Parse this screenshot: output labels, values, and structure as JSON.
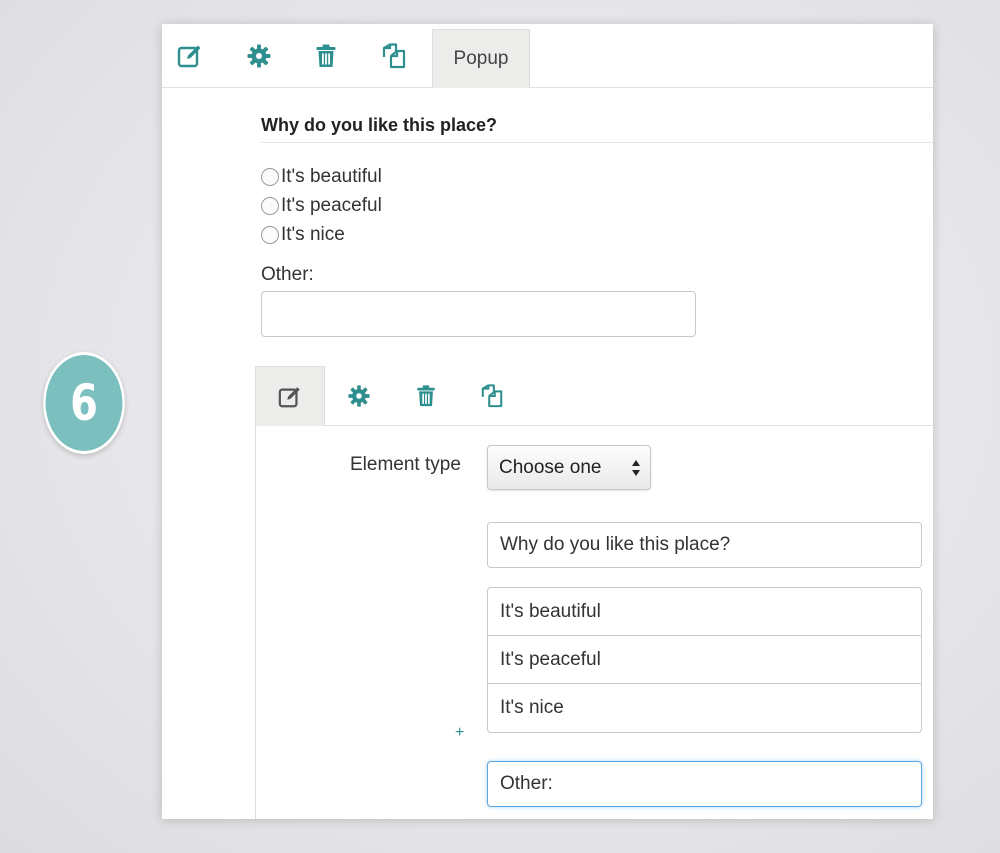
{
  "step": {
    "number": "6"
  },
  "toolbar": {
    "icons": [
      "edit-icon",
      "gear-icon",
      "trash-icon",
      "copy-icon"
    ],
    "popup_label": "Popup"
  },
  "preview": {
    "question": "Why do you like this place?",
    "options": [
      "It's beautiful",
      "It's peaceful",
      "It's nice"
    ],
    "other_label": "Other:",
    "other_value": ""
  },
  "editor": {
    "tabs": [
      "edit-icon",
      "gear-icon",
      "trash-icon",
      "copy-icon"
    ],
    "element_type_label": "Element type",
    "element_type_value": "Choose one",
    "question_value": "Why do you like this place?",
    "option_values": [
      "It's beautiful",
      "It's peaceful",
      "It's nice"
    ],
    "add_symbol": "+",
    "other_value": "Other:"
  },
  "colors": {
    "accent": "#2f8f8f",
    "badge": "#7cbfbf",
    "focus": "#5aa6e0"
  }
}
